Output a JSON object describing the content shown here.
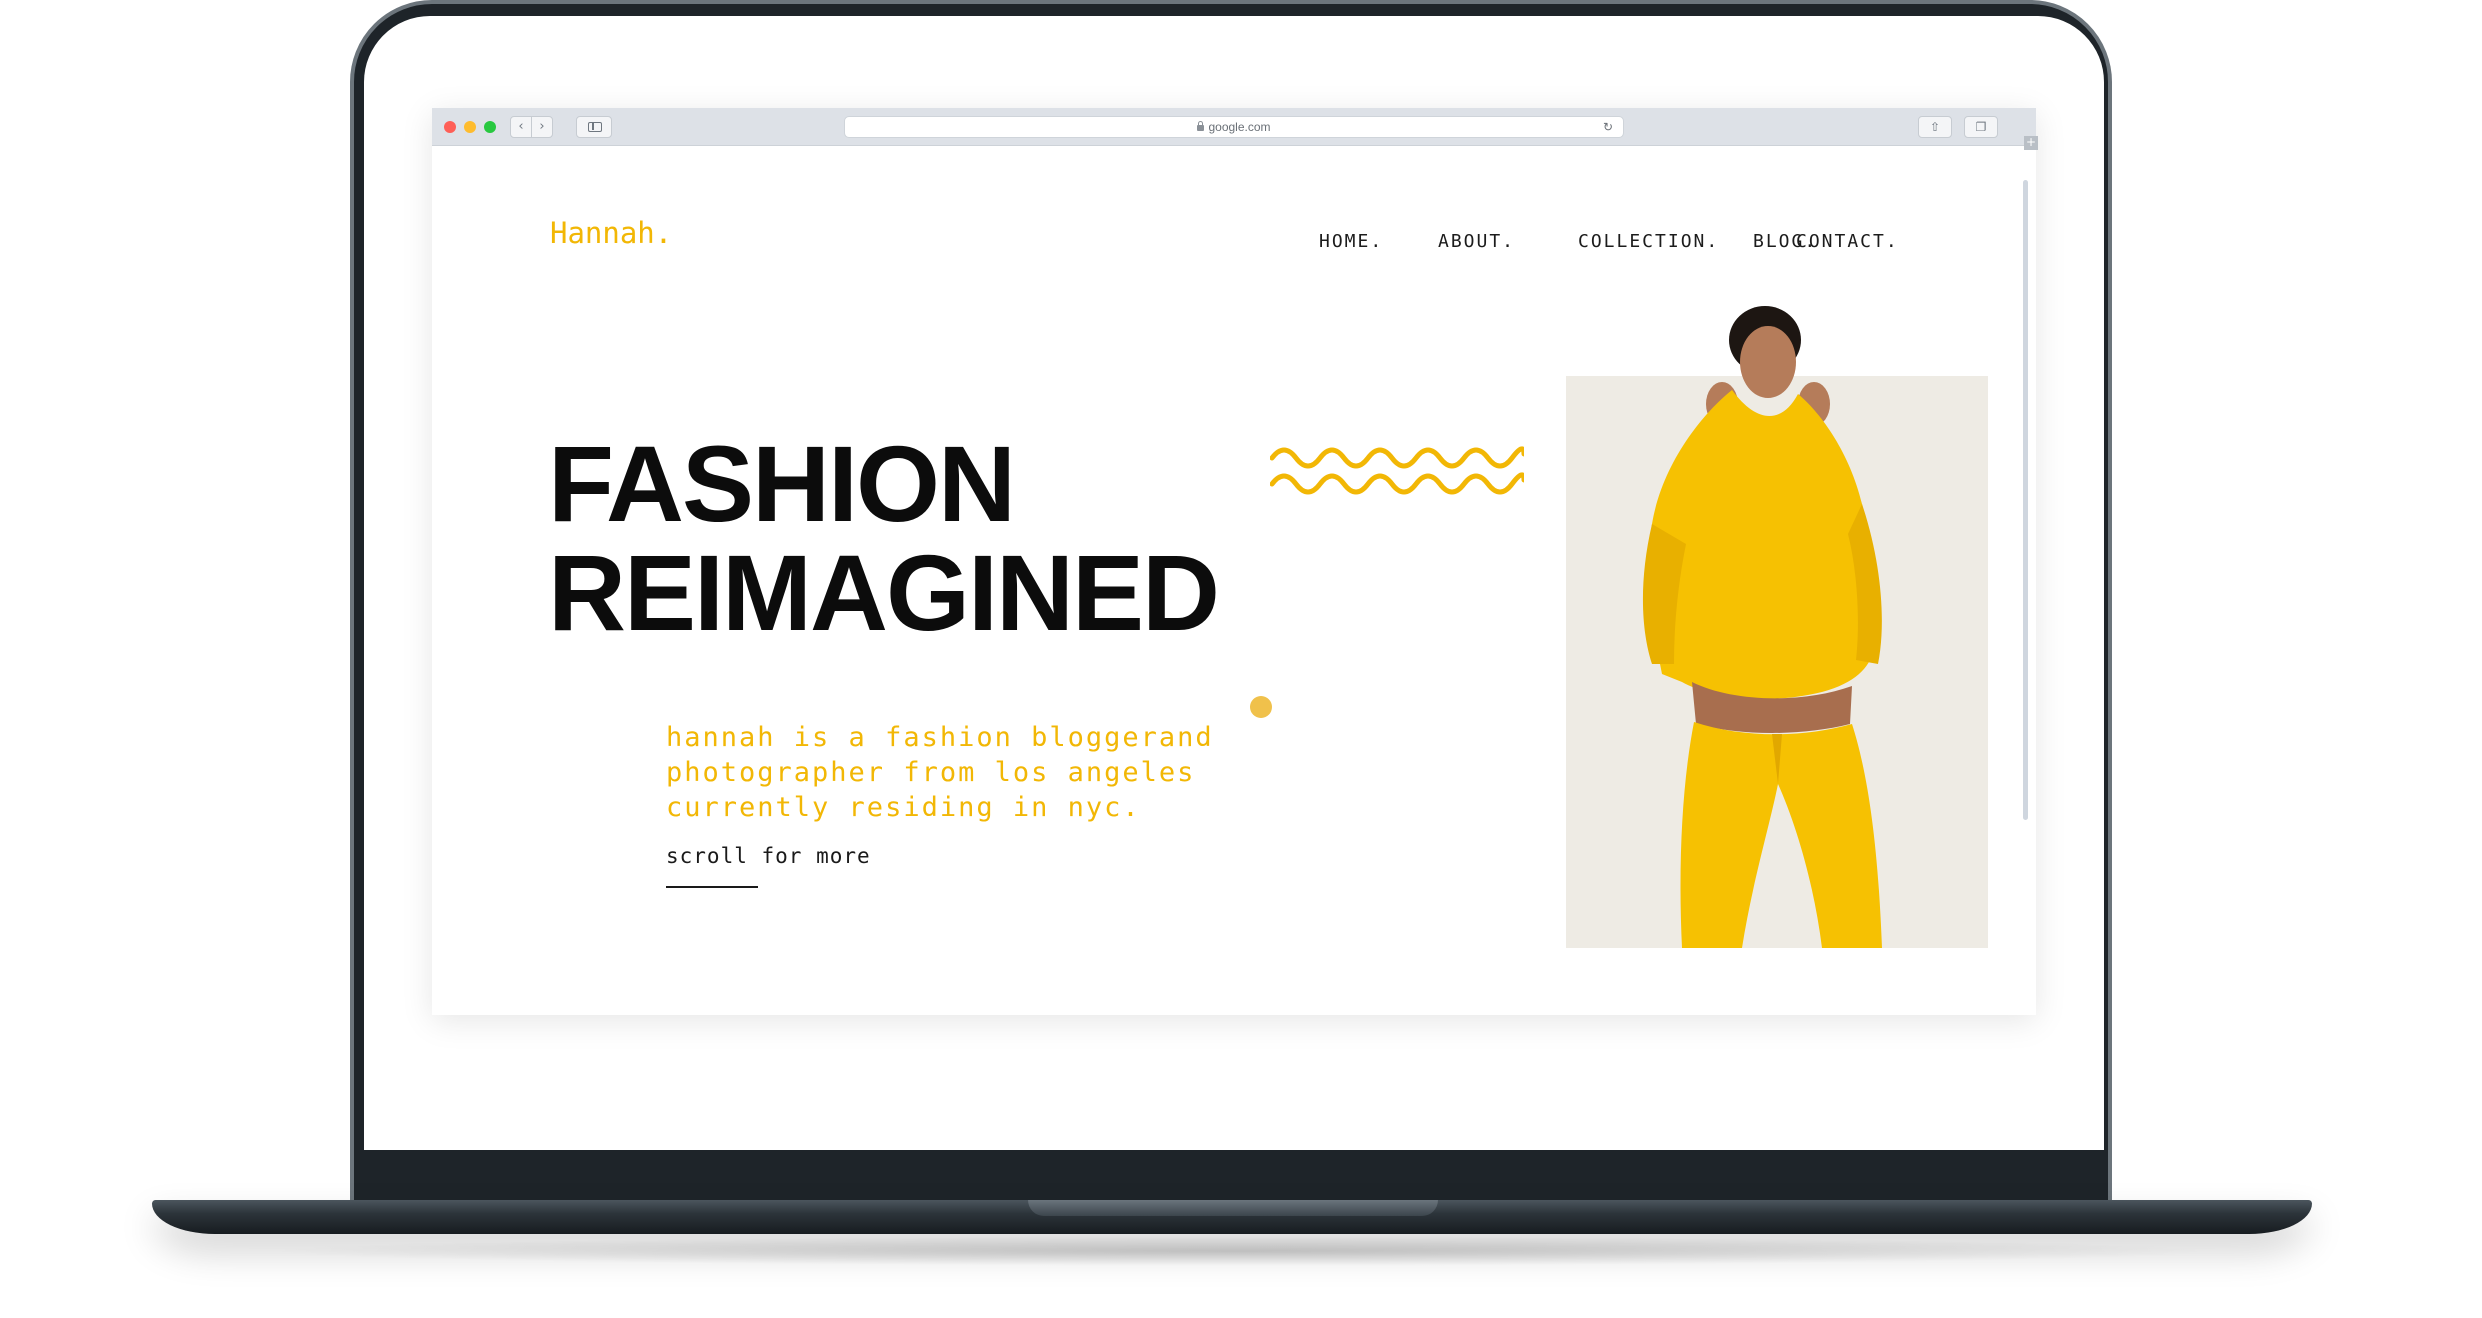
{
  "browser": {
    "url": "google.com"
  },
  "site": {
    "logo": "Hannah.",
    "nav": [
      "HOME.",
      "ABOUT.",
      "COLLECTION.",
      "BLOG.",
      "CONTACT."
    ],
    "hero": {
      "line1": "FASHION",
      "line2": "REIMAGINED",
      "description": "hannah is a fashion bloggerand photographer from los angeles currently residing in nyc.",
      "scroll_label": "scroll for more"
    }
  },
  "colors": {
    "accent": "#f2b705",
    "dot": "#f0c14b",
    "text": "#0c0c0c",
    "photo_bg": "#eeebe4"
  },
  "icons": [
    "back-arrow-icon",
    "forward-arrow-icon",
    "sidebar-icon",
    "lock-icon",
    "reload-icon",
    "share-icon",
    "tabs-icon",
    "new-tab-icon"
  ]
}
